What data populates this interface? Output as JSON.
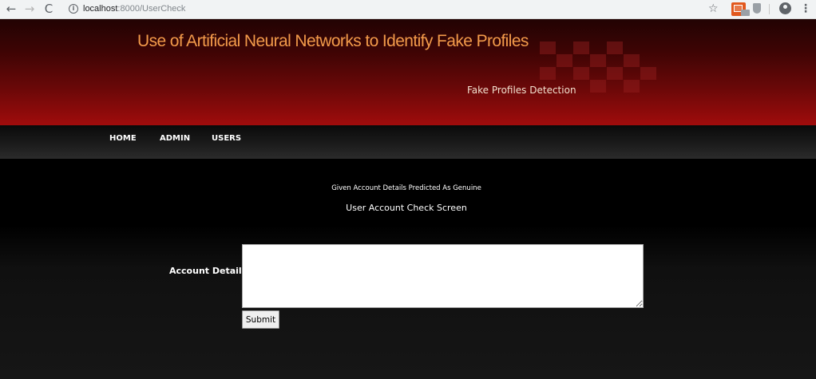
{
  "browser": {
    "back_icon": "←",
    "forward_icon": "→",
    "reload_icon": "C",
    "info_icon": "i",
    "url_host": "localhost",
    "url_rest": ":8000/UserCheck",
    "star_icon": "☆",
    "menu_icon": "⋮"
  },
  "header": {
    "title": "Use of Artificial Neural Networks to Identify Fake Profiles",
    "subtitle": "Fake Profiles Detection",
    "gradient_colors": [
      "#220303",
      "#a00c0c"
    ],
    "title_color": "#f29a4a"
  },
  "nav": {
    "items": [
      {
        "label": "HOME"
      },
      {
        "label": "ADMIN"
      },
      {
        "label": "USERS"
      }
    ]
  },
  "main": {
    "result_message": "Given Account Details Predicted As Genuine",
    "screen_title": "User Account Check Screen",
    "form": {
      "account_label": "Account Details",
      "account_value": "",
      "submit_label": "Submit"
    }
  }
}
